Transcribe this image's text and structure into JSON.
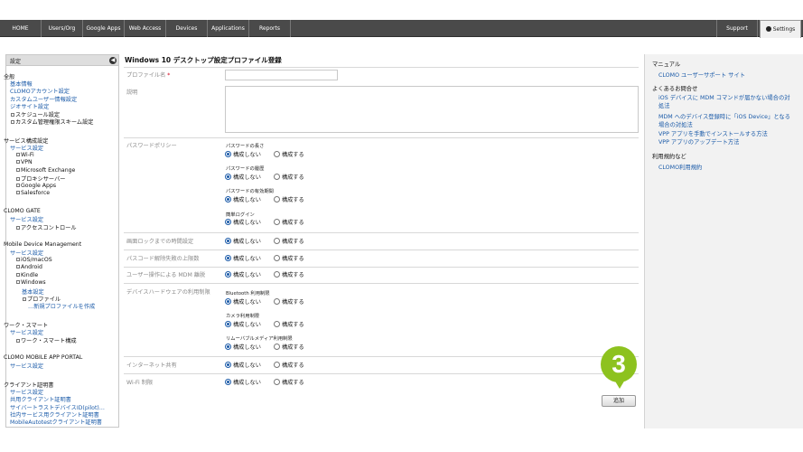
{
  "nav": {
    "items": [
      "HOME",
      "Users/Org",
      "Google Apps",
      "Web Access",
      "Devices",
      "Applications",
      "Reports"
    ],
    "support": "Support",
    "settings": "Settings"
  },
  "sidebar": {
    "header": "設定",
    "entries": [
      {
        "text": "全般",
        "cls": "h"
      },
      {
        "text": "基本情報",
        "cls": "l1"
      },
      {
        "text": "CLOMOアカウント設定",
        "cls": "l1"
      },
      {
        "text": "カスタムユーザー情報設定",
        "cls": "l1"
      },
      {
        "text": "ジオサイト設定",
        "cls": "l1"
      },
      {
        "text": "スケジュール設定",
        "cls": "l2"
      },
      {
        "text": "カスタム管理権限スキーム設定",
        "cls": "l2"
      },
      {
        "text": "サービス構成設定",
        "cls": "h"
      },
      {
        "text": "サービス設定",
        "cls": "l1"
      },
      {
        "text": "Wi-Fi",
        "cls": "l3"
      },
      {
        "text": "VPN",
        "cls": "l3"
      },
      {
        "text": "Microsoft Exchange",
        "cls": "l3"
      },
      {
        "text": "プロキシサーバー",
        "cls": "l3"
      },
      {
        "text": "Google Apps",
        "cls": "l3"
      },
      {
        "text": "Salesforce",
        "cls": "l3"
      },
      {
        "text": "CLOMO GATE",
        "cls": "h"
      },
      {
        "text": "サービス設定",
        "cls": "l1"
      },
      {
        "text": "アクセスコントロール",
        "cls": "l3"
      },
      {
        "text": "Mobile Device Management",
        "cls": "h"
      },
      {
        "text": "サービス設定",
        "cls": "l1"
      },
      {
        "text": "iOS/macOS",
        "cls": "l3"
      },
      {
        "text": "Android",
        "cls": "l3"
      },
      {
        "text": "Kindle",
        "cls": "l3"
      },
      {
        "text": "Windows",
        "cls": "l3"
      },
      {
        "text": "基本設定",
        "cls": "l4"
      },
      {
        "text": "プロファイル",
        "cls": "l4d"
      },
      {
        "text": "…新規プロファイルを作成",
        "cls": "l5"
      },
      {
        "text": "ワーク・スマート",
        "cls": "h"
      },
      {
        "text": "サービス設定",
        "cls": "l1"
      },
      {
        "text": "ワーク・スマート構成",
        "cls": "l3"
      },
      {
        "text": "CLOMO MOBILE APP PORTAL",
        "cls": "h"
      },
      {
        "text": "サービス設定",
        "cls": "l1"
      },
      {
        "text": "クライアント証明書",
        "cls": "h"
      },
      {
        "text": "サービス設定",
        "cls": "l1"
      },
      {
        "text": "共用クライアント証明書",
        "cls": "l1"
      },
      {
        "text": "サイバートラストデバイスID(pilot)…",
        "cls": "l1"
      },
      {
        "text": "社内サービス用クライアント証明書",
        "cls": "l1"
      },
      {
        "text": "MobileAutotestクライアント証明書",
        "cls": "l1"
      }
    ]
  },
  "main": {
    "title": "Windows 10 デスクトップ設定プロファイル登録",
    "profile_name_label": "プロファイル名",
    "required_mark": "*",
    "description_label": "説明",
    "password_policy_label": "パスワードポリシー",
    "pw_length": "パスワードの長さ",
    "pw_history": "パスワードの履歴",
    "pw_expiry": "パスワードの有効期間",
    "simple_login": "簡単ログイン",
    "screen_lock_label": "画面ロックまでの時間設定",
    "passcode_fail_label": "パスコード解除失敗の上限数",
    "mdm_removal_label": "ユーザー操作による MDM 離脱",
    "device_hw_label": "デバイスハードウェアの利用制限",
    "bluetooth": "Bluetooth 利用制限",
    "camera": "カメラ利用制限",
    "removable_media": "リムーバブルメディア利用制限",
    "internet_sharing_label": "インターネット共有",
    "wifi_label": "Wi-Fi 制限",
    "opt_no_config": "構成しない",
    "opt_config": "構成する",
    "add_button": "追加",
    "step_number": "3"
  },
  "right": {
    "manual_head": "マニュアル",
    "manual_link": "CLOMO ユーザーサポート サイト",
    "faq_head": "よくあるお問合せ",
    "faq1a": "iOS デバイスに MDM コマンドが届かない場合の対",
    "faq1b": "処法",
    "faq2a": "MDM へのデバイス登録時に「iOS Device」となる",
    "faq2b": "場合の対処法",
    "faq3": "VPP アプリを手動でインストールする方法",
    "faq4": "VPP アプリのアップデート方法",
    "terms_head": "利用規約など",
    "terms_link": "CLOMO利用規約"
  },
  "colors": {
    "accent_green": "#8dc21f",
    "link_blue": "#1a5aa8",
    "nav_bg": "#4a4a4a"
  }
}
